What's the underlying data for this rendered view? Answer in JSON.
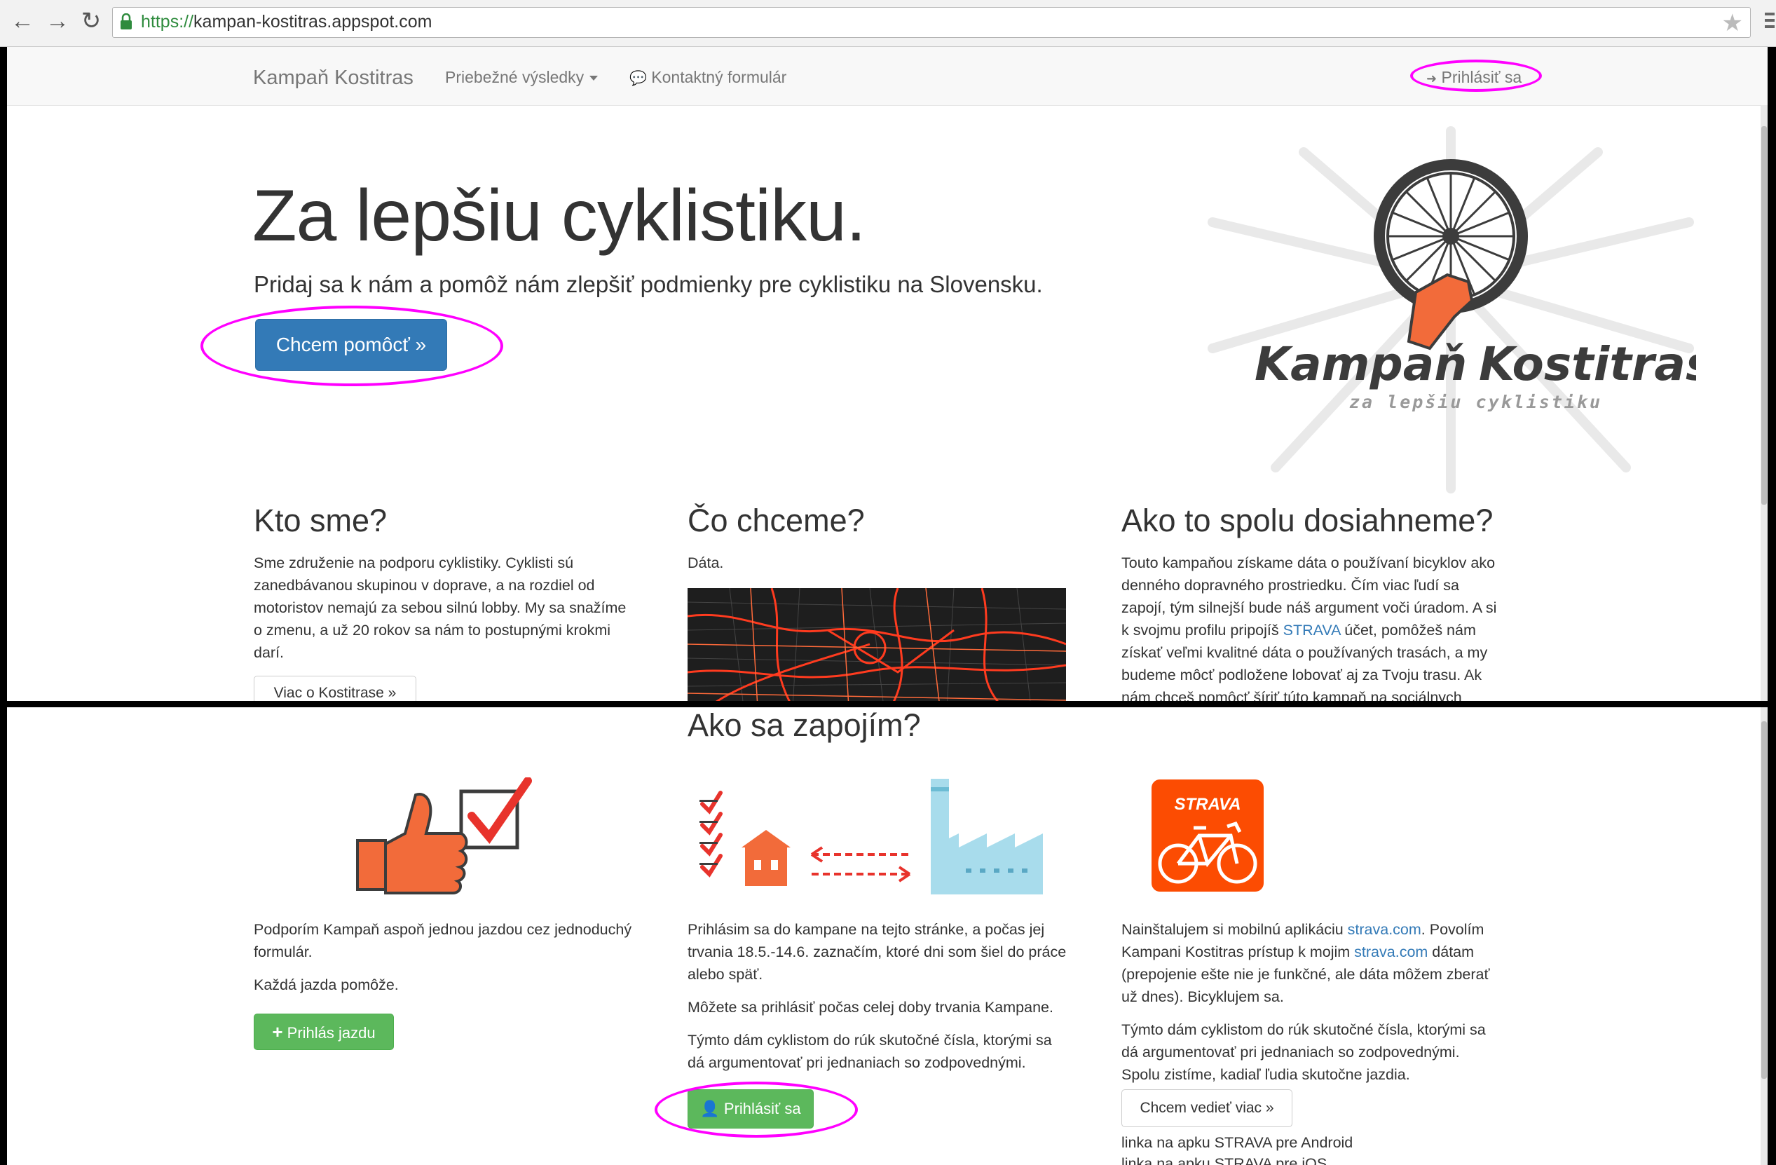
{
  "browser": {
    "url_scheme": "https://",
    "url_host": "kampan-kostitras.appspot.com"
  },
  "navbar": {
    "brand": "Kampaň Kostitras",
    "results": "Priebežné výsledky",
    "contact": "Kontaktný formulár",
    "login": "Prihlásiť sa"
  },
  "hero": {
    "title": "Za lepšiu cyklistiku.",
    "subtitle": "Pridaj sa k nám a pomôž nám zlepšiť podmienky pre cyklistiku na Slovensku.",
    "cta": "Chcem pomôcť »"
  },
  "logo": {
    "word1": "Kampaň",
    "word2": "Kostitras",
    "tagline": "za lepšiu cyklistiku"
  },
  "columns": {
    "who": {
      "title": "Kto sme?",
      "lines": [
        "Sme združenie na podporu cyklistiky. Cyklisti sú",
        "zanedbávanou skupinou v doprave, a na rozdiel od",
        "motoristov nemajú za sebou silnú lobby. My sa snažíme",
        "o zmenu, a už 20 rokov sa nám to postupnými krokmi",
        "darí."
      ],
      "button": "Viac o Kostitrase »"
    },
    "what": {
      "title": "Čo chceme?",
      "text": "Dáta."
    },
    "how": {
      "title": "Ako to spolu dosiahneme?",
      "line1": "Touto kampaňou získame dáta o používaní bicyklov ako",
      "line2": "denného dopravného prostriedku. Čím viac ľudí sa",
      "line3": "zapojí, tým silnejší bude náš argument voči úradom. A si",
      "line4_a": "k svojmu profilu pripojíš ",
      "line4_link": "STRAVA",
      "line4_b": " účet, pomôžeš nám",
      "line5": "získať veľmi kvalitné dáta o používaných trasách, a my",
      "line6": "budeme môcť podložene lobovať aj za Tvoju trasu. Ak",
      "line7": "nám chceš pomôcť šíriť túto kampaň na sociálnych"
    }
  },
  "join": {
    "title": "Ako sa zapojím?",
    "col1": {
      "p1_l1": "Podporím Kampaň aspoň jednou jazdou cez jednoduchý",
      "p1_l2": "formulár.",
      "p2": "Každá jazda pomôže.",
      "button": "Prihlás jazdu"
    },
    "col2": {
      "p1_l1": "Prihlásim sa do kampane na tejto stránke, a počas jej",
      "p1_l2": "trvania 18.5.-14.6. zaznačím, ktoré dni som šiel do práce",
      "p1_l3": "alebo späť.",
      "p2": "Môžete sa prihlásiť počas celej doby trvania Kampane.",
      "p3_l1": "Týmto dám cyklistom do rúk skutočné čísla, ktorými sa",
      "p3_l2": "dá argumentovať pri jednaniach so zodpovednými.",
      "button": "Prihlásiť sa"
    },
    "col3": {
      "strava_badge": "STRAVA",
      "p1_a": "Nainštalujem si mobilnú aplikáciu ",
      "p1_link1": "strava.com",
      "p1_b": ". Povolím",
      "p1_c": "Kampani Kostitras prístup k mojim ",
      "p1_link2": "strava.com",
      "p1_d": " dátam",
      "p1_l3": "(prepojenie ešte nie je funkčné, ale dáta môžem zberať",
      "p1_l4": "už dnes). Bicyklujem sa.",
      "p2_l1": "Týmto dám cyklistom do rúk skutočné čísla, ktorými sa",
      "p2_l2": "dá argumentovať pri jednaniach so zodpovednými.",
      "p2_l3": "Spolu zistíme, kadiaľ ľudia skutočne jazdia.",
      "button": "Chcem vedieť viac »",
      "link_android": "linka na apku STRAVA pre Android",
      "link_ios": "linka na apku STRAVA pre iOS"
    }
  },
  "colors": {
    "primary": "#337ab7",
    "success": "#5cb85c",
    "accent_orange": "#f26b3a",
    "highlight": "#ff00ff",
    "strava": "#fc4c02"
  }
}
